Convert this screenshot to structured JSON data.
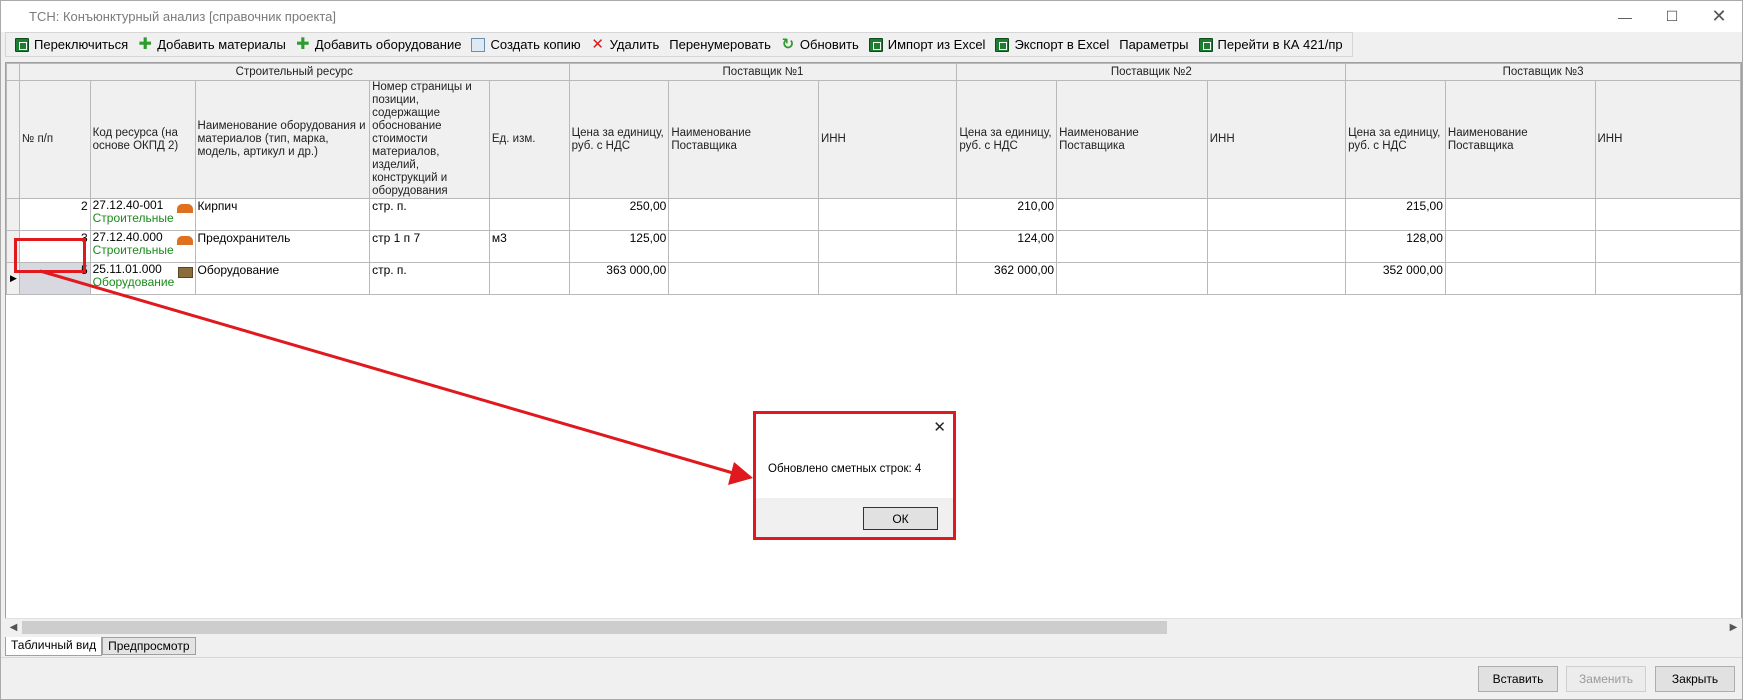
{
  "window": {
    "title": "ТСН: Конъюнктурный анализ [справочник проекта]",
    "controls": {
      "minimize": "—",
      "maximize": "☐",
      "close": "✕"
    }
  },
  "toolbar": {
    "items": [
      {
        "label": "Переключиться",
        "icon": "spreadsheet-icon"
      },
      {
        "label": "Добавить материалы",
        "icon": "plus-icon"
      },
      {
        "label": "Добавить оборудование",
        "icon": "plus-icon"
      },
      {
        "label": "Создать копию",
        "icon": "copy-icon"
      },
      {
        "label": "Удалить",
        "icon": "delete-icon"
      },
      {
        "label": "Перенумеровать",
        "icon": ""
      },
      {
        "label": "Обновить",
        "icon": "refresh-icon"
      },
      {
        "label": "Импорт из Excel",
        "icon": "excel-icon"
      },
      {
        "label": "Экспорт в Excel",
        "icon": "excel-icon"
      },
      {
        "label": "Параметры",
        "icon": ""
      },
      {
        "label": "Перейти в КА 421/пр",
        "icon": "spreadsheet-icon"
      }
    ]
  },
  "grid": {
    "groups": {
      "resource": "Строительный ресурс",
      "supplier1": "Поставщик №1",
      "supplier2": "Поставщик №2",
      "supplier3": "Поставщик №3"
    },
    "columns": {
      "num": "№ п/п",
      "code": "Код ресурса (на основе ОКПД 2)",
      "name": "Наименование оборудования и материалов (тип, марка, модель, артикул и др.)",
      "page": "Номер страницы и позиции, содержащие обоснование стоимости материалов, изделий, конструкций и оборудования",
      "unit": "Ед. изм.",
      "price": "Цена за единицу, руб. с НДС",
      "supplier_name": "Наименование Поставщика",
      "inn": "ИНН"
    },
    "rows": [
      {
        "num": "2",
        "code": "27.12.40-001",
        "category": "Строительные",
        "name": "Кирпич",
        "page": "стр. п.",
        "unit": "",
        "p1": "250,00",
        "s1": "",
        "i1": "",
        "p2": "210,00",
        "s2": "",
        "i2": "",
        "p3": "215,00",
        "s3": "",
        "i3": ""
      },
      {
        "num": "3",
        "code": "27.12.40.000",
        "category": "Строительные",
        "name": "Предохранитель",
        "page": "стр 1 п 7",
        "unit": "м3",
        "p1": "125,00",
        "s1": "",
        "i1": "",
        "p2": "124,00",
        "s2": "",
        "i2": "",
        "p3": "128,00",
        "s3": "",
        "i3": ""
      },
      {
        "num": "5",
        "code": "25.11.01.000",
        "category": "Оборудование",
        "name": "Оборудование",
        "page": "стр. п.",
        "unit": "",
        "p1": "363 000,00",
        "s1": "",
        "i1": "",
        "p2": "362 000,00",
        "s2": "",
        "i2": "",
        "p3": "352 000,00",
        "s3": "",
        "i3": ""
      }
    ]
  },
  "tabs": {
    "table_view": "Табличный вид",
    "preview": "Предпросмотр"
  },
  "buttons": {
    "insert": "Вставить",
    "replace": "Заменить",
    "close": "Закрыть"
  },
  "dialog": {
    "message": "Обновлено сметных строк: 4",
    "ok": "ОК",
    "close": "✕"
  },
  "colors": {
    "annotation": "#e0191f",
    "category_text": "#1a8c1a"
  }
}
